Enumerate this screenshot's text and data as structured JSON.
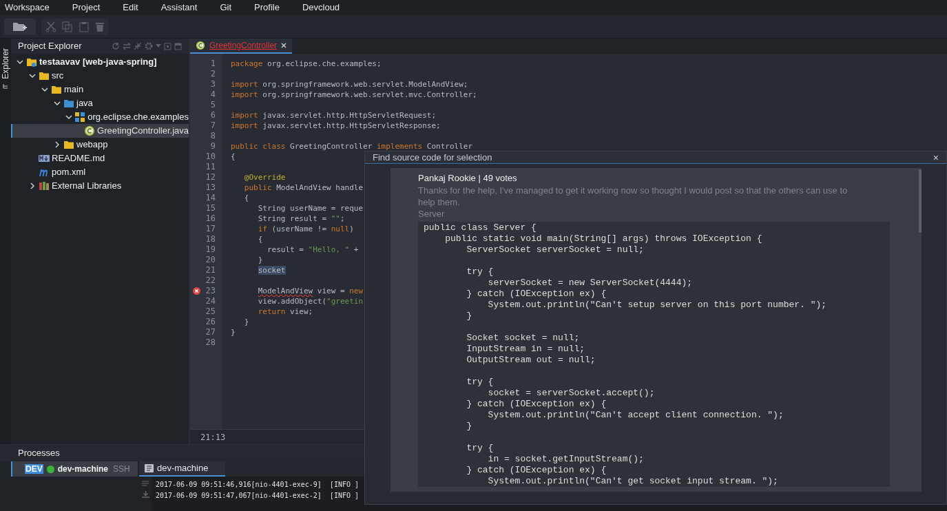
{
  "menu": [
    "Workspace",
    "Project",
    "Edit",
    "Assistant",
    "Git",
    "Profile",
    "Devcloud"
  ],
  "explorer": {
    "title": "Project Explorer",
    "side_tab": "Explorer",
    "tree": [
      {
        "label": "testaavav [web-java-spring]",
        "kind": "project",
        "expanded": true,
        "selected": false,
        "children": [
          {
            "label": "src",
            "kind": "folder",
            "expanded": true,
            "selected": false,
            "children": [
              {
                "label": "main",
                "kind": "folder",
                "expanded": true,
                "selected": false,
                "children": [
                  {
                    "label": "java",
                    "kind": "source",
                    "expanded": true,
                    "selected": false,
                    "children": [
                      {
                        "label": "org.eclipse.che.examples",
                        "kind": "package",
                        "expanded": true,
                        "selected": false,
                        "children": [
                          {
                            "label": "GreetingController.java",
                            "kind": "class",
                            "selected": true
                          }
                        ]
                      }
                    ]
                  },
                  {
                    "label": "webapp",
                    "kind": "folder",
                    "expanded": false,
                    "selected": false
                  }
                ]
              }
            ]
          },
          {
            "label": "README.md",
            "kind": "markdown",
            "selected": false
          },
          {
            "label": "pom.xml",
            "kind": "maven",
            "selected": false
          },
          {
            "label": "External Libraries",
            "kind": "library",
            "expanded": false,
            "selected": false
          }
        ]
      }
    ]
  },
  "editor": {
    "tabs": [
      {
        "label": "GreetingController",
        "error": true,
        "selected": true
      }
    ],
    "lines": [
      {
        "number": "1",
        "tokens": [
          {
            "kind": "kw",
            "text": "package"
          },
          {
            "kind": "plain",
            "text": " org.eclipse.che.examples;"
          }
        ]
      },
      {
        "number": "2"
      },
      {
        "number": "3",
        "tokens": [
          {
            "kind": "kw",
            "text": "import"
          },
          {
            "kind": "plain",
            "text": " org.springframework.web.servlet.ModelAndView;"
          }
        ]
      },
      {
        "number": "4",
        "tokens": [
          {
            "kind": "kw",
            "text": "import"
          },
          {
            "kind": "plain",
            "text": " org.springframework.web.servlet.mvc.Controller;"
          }
        ]
      },
      {
        "number": "5"
      },
      {
        "number": "6",
        "tokens": [
          {
            "kind": "kw",
            "text": "import"
          },
          {
            "kind": "plain",
            "text": " javax.servlet.http.HttpServletRequest;"
          }
        ]
      },
      {
        "number": "7",
        "tokens": [
          {
            "kind": "kw",
            "text": "import"
          },
          {
            "kind": "plain",
            "text": " javax.servlet.http.HttpServletResponse;"
          }
        ]
      },
      {
        "number": "8"
      },
      {
        "number": "9",
        "tokens": [
          {
            "kind": "kw",
            "text": "public class"
          },
          {
            "kind": "plain",
            "text": " GreetingController "
          },
          {
            "kind": "kw",
            "text": "implements"
          },
          {
            "kind": "plain",
            "text": " Controller"
          }
        ]
      },
      {
        "number": "10",
        "tokens": [
          {
            "kind": "plain",
            "text": "{"
          }
        ]
      },
      {
        "number": "11"
      },
      {
        "number": "12",
        "tokens": [
          {
            "kind": "ann",
            "text": "   @Override"
          }
        ]
      },
      {
        "number": "13",
        "tokens": [
          {
            "kind": "kw",
            "text": "   public"
          },
          {
            "kind": "plain",
            "text": " ModelAndView handle"
          }
        ]
      },
      {
        "number": "14",
        "tokens": [
          {
            "kind": "plain",
            "text": "   {"
          }
        ]
      },
      {
        "number": "15",
        "tokens": [
          {
            "kind": "plain",
            "text": "      String userName = reque"
          }
        ]
      },
      {
        "number": "16",
        "tokens": [
          {
            "kind": "plain",
            "text": "      String result = "
          },
          {
            "kind": "str",
            "text": "\"\""
          },
          {
            "kind": "plain",
            "text": ";"
          }
        ]
      },
      {
        "number": "17",
        "tokens": [
          {
            "kind": "kw",
            "text": "      if"
          },
          {
            "kind": "plain",
            "text": " (userName != "
          },
          {
            "kind": "kw",
            "text": "null"
          },
          {
            "kind": "plain",
            "text": ")"
          }
        ]
      },
      {
        "number": "18",
        "tokens": [
          {
            "kind": "plain",
            "text": "      {"
          }
        ]
      },
      {
        "number": "19",
        "tokens": [
          {
            "kind": "plain",
            "text": "        result = "
          },
          {
            "kind": "str",
            "text": "\"Hello, \""
          },
          {
            "kind": "plain",
            "text": " +"
          }
        ]
      },
      {
        "number": "20",
        "tokens": [
          {
            "kind": "plain",
            "text": "      }"
          }
        ]
      },
      {
        "number": "21",
        "tokens": [
          {
            "kind": "selected",
            "text": "      socket"
          }
        ]
      },
      {
        "number": "22"
      },
      {
        "number": "23",
        "error": true,
        "tokens": [
          {
            "kind": "error",
            "text": "      ModelAndView"
          },
          {
            "kind": "plain",
            "text": " view = "
          },
          {
            "kind": "kw",
            "text": "new"
          }
        ]
      },
      {
        "number": "24",
        "tokens": [
          {
            "kind": "plain",
            "text": "      view.addObject("
          },
          {
            "kind": "str",
            "text": "\"greetin"
          }
        ]
      },
      {
        "number": "25",
        "tokens": [
          {
            "kind": "kw",
            "text": "      return"
          },
          {
            "kind": "plain",
            "text": " view;"
          }
        ]
      },
      {
        "number": "26",
        "tokens": [
          {
            "kind": "plain",
            "text": "   }"
          }
        ]
      },
      {
        "number": "27",
        "tokens": [
          {
            "kind": "plain",
            "text": "}"
          }
        ]
      },
      {
        "number": "28"
      }
    ],
    "cursor": "21:13"
  },
  "popup": {
    "title": "Find source code for selection",
    "close": "×",
    "answer": {
      "header": "Pankaj Rookie | 49 votes",
      "text": "Thanks for the help, I've managed to get it working now so thought I would post so that the others can use to help them.",
      "label": "Server",
      "code": "public class Server {\n    public static void main(String[] args) throws IOException {\n        ServerSocket serverSocket = null;\n\n        try {\n            serverSocket = new ServerSocket(4444);\n        } catch (IOException ex) {\n            System.out.println(\"Can't setup server on this port number. \");\n        }\n\n        Socket socket = null;\n        InputStream in = null;\n        OutputStream out = null;\n\n        try {\n            socket = serverSocket.accept();\n        } catch (IOException ex) {\n            System.out.println(\"Can't accept client connection. \");\n        }\n\n        try {\n            in = socket.getInputStream();\n        } catch (IOException ex) {\n            System.out.println(\"Can't get socket input stream. \");"
    }
  },
  "processes": {
    "title": "Processes",
    "machines": [
      {
        "badge": "DEV",
        "name": "dev-machine",
        "running": true,
        "terminal": "SSH",
        "selected": true
      }
    ],
    "console": {
      "tabs": [
        {
          "label": "dev-machine",
          "selected": true
        }
      ],
      "lines": [
        "2017-06-09 09:51:46,916[nio-4401-exec-9]  [INFO ]",
        "2017-06-09 09:51:47,067[nio-4401-exec-2]  [INFO ]"
      ]
    }
  }
}
